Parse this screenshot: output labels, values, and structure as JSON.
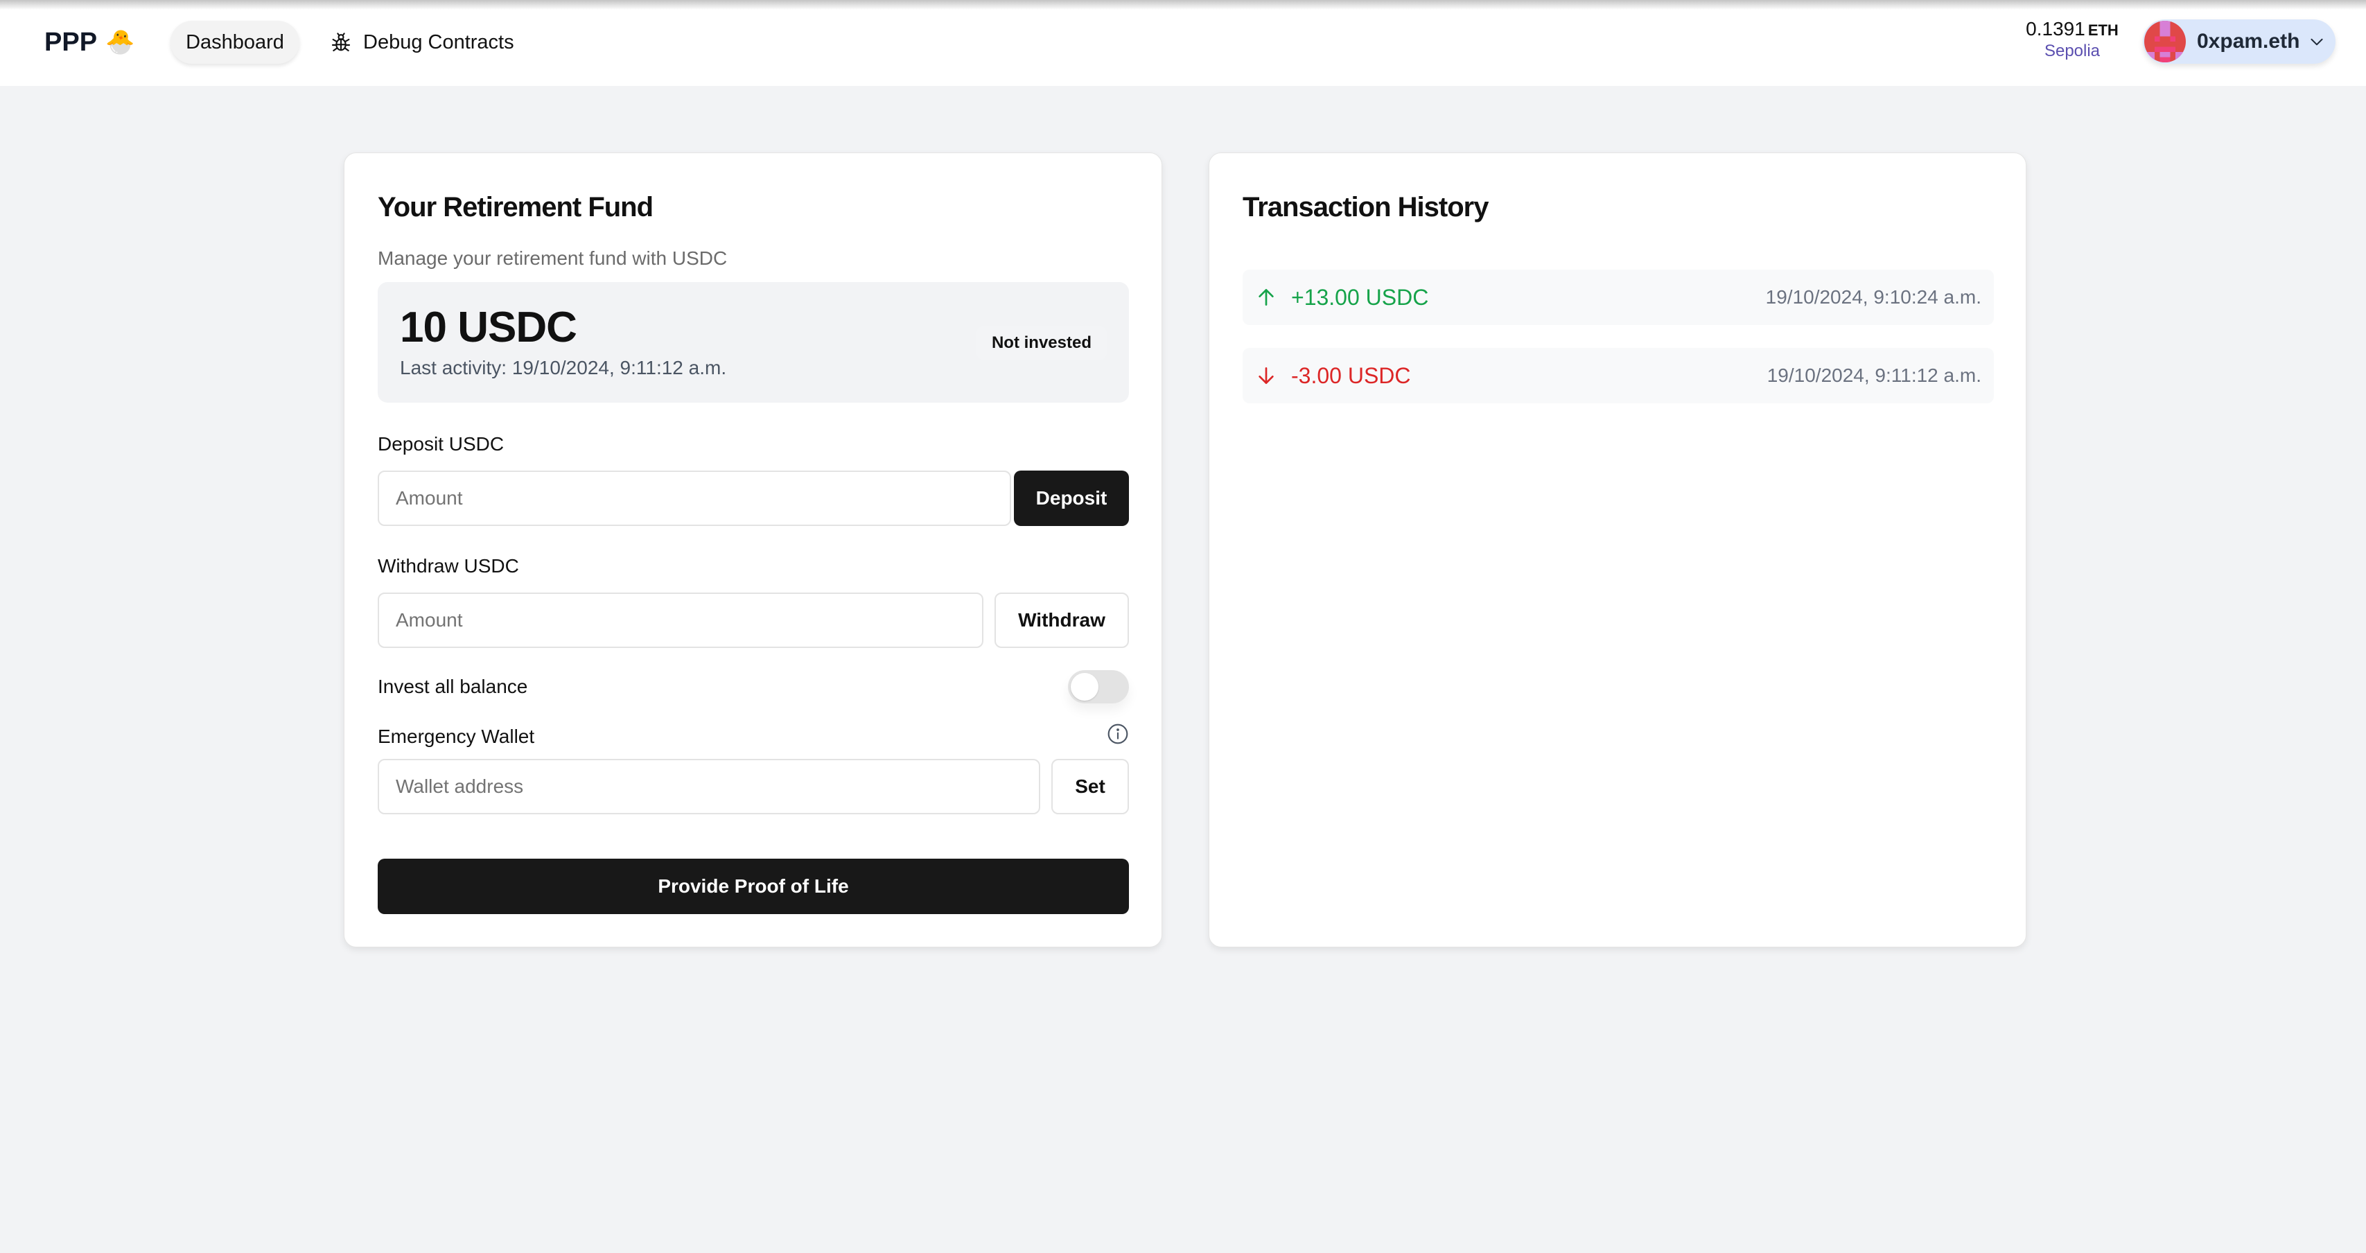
{
  "header": {
    "logo_text": "PPP",
    "logo_emoji": "🐣",
    "nav": [
      {
        "label": "Dashboard",
        "active": true
      },
      {
        "label": "Debug Contracts",
        "icon": "bug-icon",
        "active": false
      }
    ],
    "balance": {
      "amount": "0.1391",
      "unit": "ETH",
      "network": "Sepolia"
    },
    "wallet": {
      "name": "0xpam.eth"
    }
  },
  "fund": {
    "title": "Your Retirement Fund",
    "subtitle": "Manage your retirement fund with USDC",
    "balance": "10 USDC",
    "last_activity": "Last activity: 19/10/2024, 9:11:12 a.m.",
    "status_badge": "Not invested",
    "deposit": {
      "label": "Deposit USDC",
      "placeholder": "Amount",
      "value": "",
      "button": "Deposit"
    },
    "withdraw": {
      "label": "Withdraw USDC",
      "placeholder": "Amount",
      "value": "",
      "button": "Withdraw"
    },
    "invest_all": {
      "label": "Invest all balance",
      "enabled": false
    },
    "emergency_wallet": {
      "label": "Emergency Wallet",
      "placeholder": "Wallet address",
      "value": "",
      "button": "Set"
    },
    "proof_button": "Provide Proof of Life"
  },
  "history": {
    "title": "Transaction History",
    "transactions": [
      {
        "direction": "in",
        "amount": "+13.00 USDC",
        "date": "19/10/2024, 9:10:24 a.m.",
        "color": "#16a34a"
      },
      {
        "direction": "out",
        "amount": "-3.00 USDC",
        "date": "19/10/2024, 9:11:12 a.m.",
        "color": "#dc2626"
      }
    ]
  }
}
